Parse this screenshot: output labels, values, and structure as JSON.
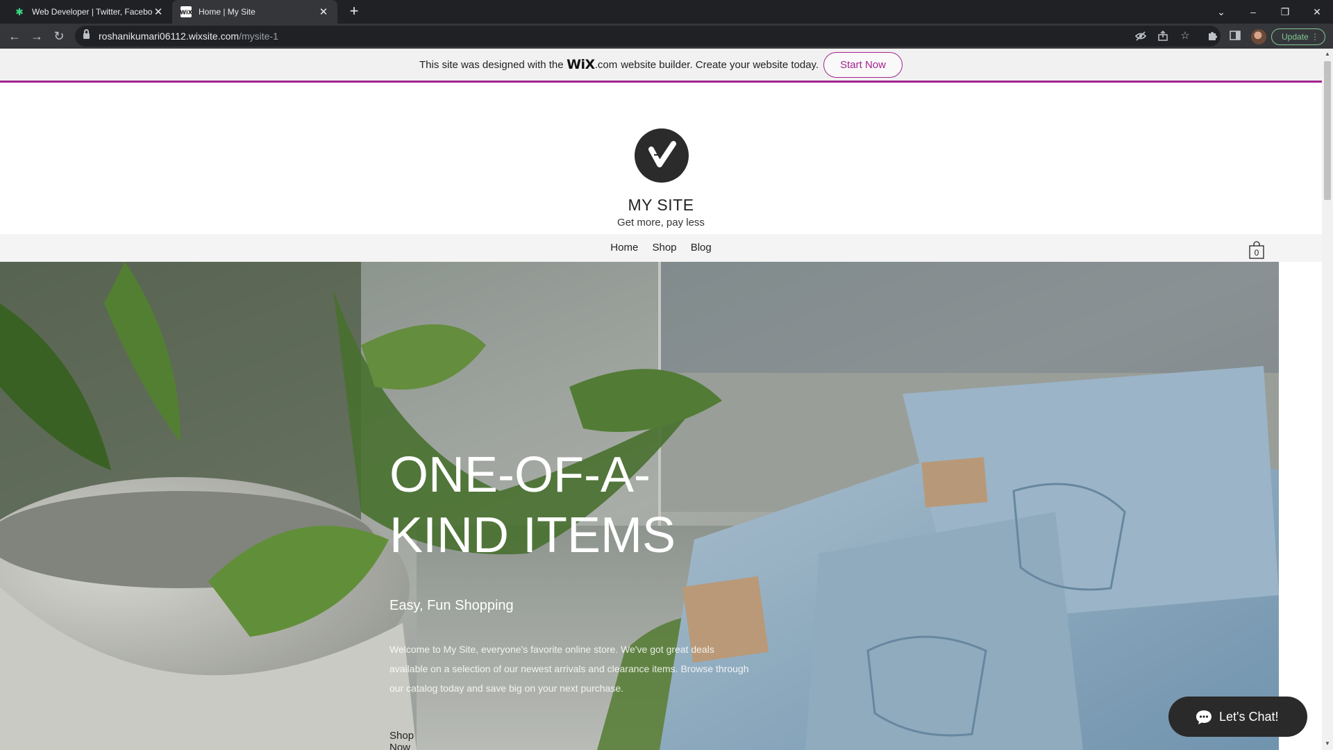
{
  "browser": {
    "tabs": [
      {
        "title": "Web Developer | Twitter, Faceboo",
        "favicon": "asterisk-icon"
      },
      {
        "title": "Home | My Site",
        "favicon": "wix-icon",
        "active": true
      }
    ],
    "address": {
      "host": "roshanikumari06112.wixsite.com",
      "path": "/mysite-1"
    },
    "update_label": "Update"
  },
  "wix_banner": {
    "text_before": "This site was designed with the",
    "logo": "WiX",
    "dotcom": ".com",
    "text_after": "website builder. Create your website today.",
    "cta": "Start Now",
    "accent": "#a3238e"
  },
  "site": {
    "logo_letter": "V",
    "title": "MY SITE",
    "tagline": "Get more, pay less"
  },
  "nav": {
    "items": [
      {
        "label": "Home"
      },
      {
        "label": "Shop"
      },
      {
        "label": "Blog"
      }
    ],
    "cart_count": "0"
  },
  "hero": {
    "title": "ONE-OF-A-\nKIND ITEMS",
    "subtitle": "Easy, Fun Shopping",
    "body": "Welcome to My Site, everyone's favorite online store. We've got great deals available on a selection of our newest arrivals and clearance items. Browse through our catalog today and save big on your next purchase.",
    "cta": "Shop Now"
  },
  "chat": {
    "label": "Let's Chat!"
  }
}
